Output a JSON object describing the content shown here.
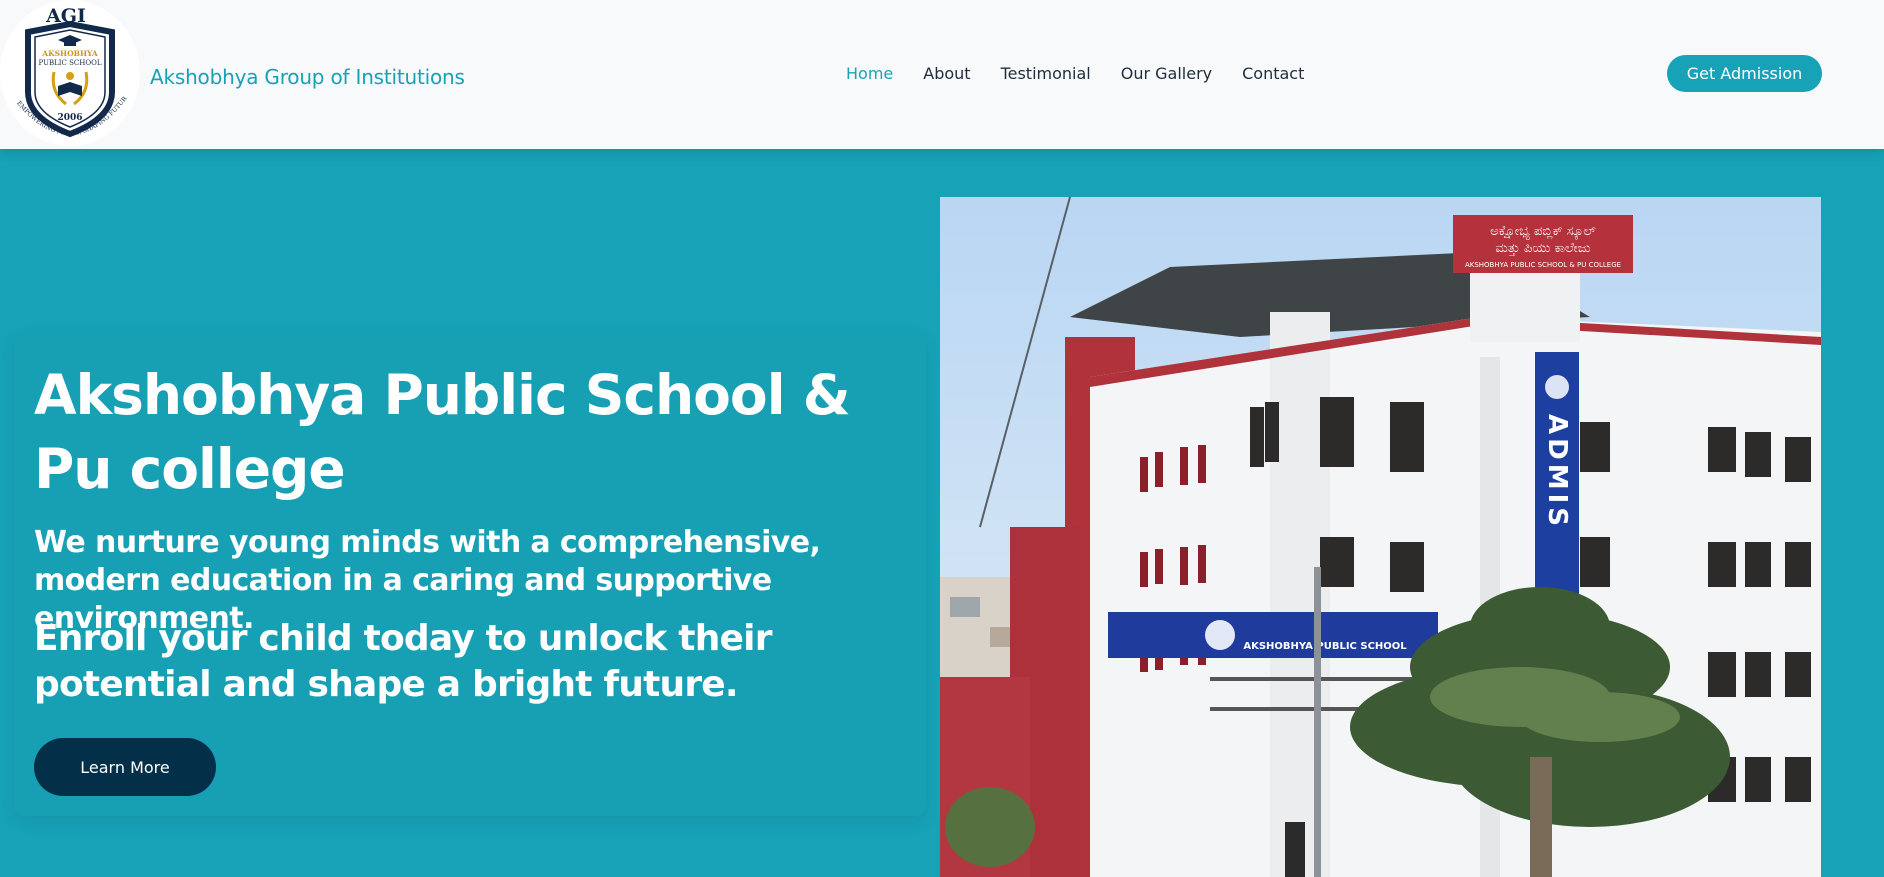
{
  "logo": {
    "acronym": "AGI",
    "school_line1": "AKSHOBHYA",
    "school_line2": "PUBLIC SCHOOL",
    "year": "2006",
    "motto": "EMPOWERING MINDS, SHAPING FUTURES"
  },
  "header": {
    "brand": "Akshobhya Group of Institutions",
    "nav": [
      "Home",
      "About",
      "Testimonial",
      "Our Gallery",
      "Contact"
    ],
    "active_nav": "Home",
    "cta": "Get Admission"
  },
  "hero": {
    "title": "Akshobhya Public School & Pu college",
    "subtitle": "We nurture young minds with a comprehensive, modern education in a caring and supportive environment.",
    "tagline": "Enroll your child today to unlock their potential and shape a bright future.",
    "button": "Learn More"
  },
  "photo": {
    "sign_kannada_1": "ಅಕ್ಷೋಭ್ಯ ಪಬ್ಲಿಕ್ ಸ್ಕೂಲ್",
    "sign_kannada_2": "ಮತ್ತು ಪಿಯು ಕಾಲೇಜು",
    "sign_english": "AKSHOBHYA PUBLIC SCHOOL & PU COLLEGE",
    "banner_text": "AKSHOBHYA PUBLIC SCHOOL",
    "vertical_banner": "ADMIS"
  },
  "colors": {
    "primary": "#17a2b8",
    "dark": "#042f48",
    "header_bg": "#f8f9fa"
  }
}
